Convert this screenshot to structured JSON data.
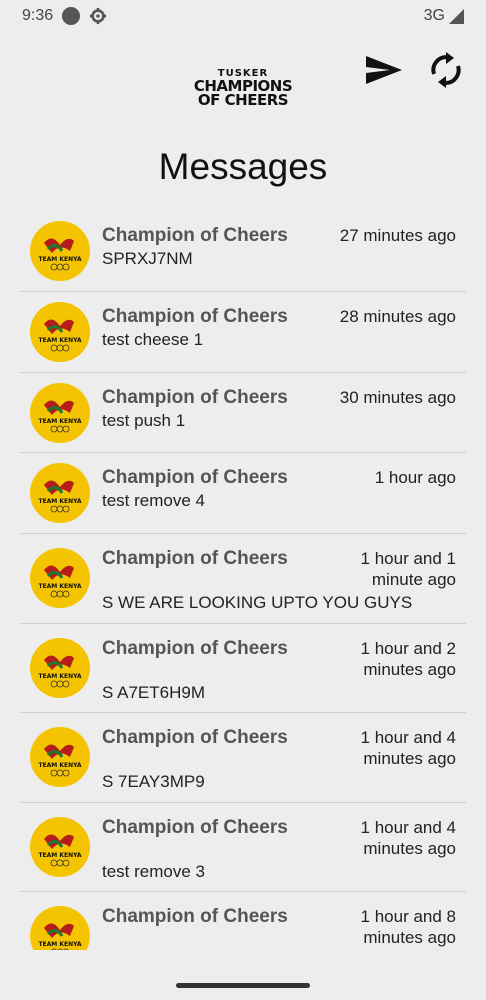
{
  "status_bar": {
    "time": "9:36",
    "network": "3G"
  },
  "header": {
    "logo_line1": "TUSKER",
    "logo_line2": "CHAMPIONS",
    "logo_line3": "OF CHEERS",
    "title": "Messages"
  },
  "avatar_text": "TEAM KENYA",
  "messages": [
    {
      "sender": "Champion of Cheers",
      "time": "27 minutes ago",
      "body": "SPRXJ7NM"
    },
    {
      "sender": "Champion of Cheers",
      "time": "28 minutes ago",
      "body": "test cheese 1"
    },
    {
      "sender": "Champion of Cheers",
      "time": "30 minutes ago",
      "body": "test push 1"
    },
    {
      "sender": "Champion of Cheers",
      "time": "1 hour ago",
      "body": "test remove 4"
    },
    {
      "sender": "Champion of Cheers",
      "time": "1 hour and 1 minute ago",
      "body": "S WE ARE LOOKING UPTO YOU GUYS"
    },
    {
      "sender": "Champion of Cheers",
      "time": "1 hour and 2 minutes ago",
      "body": "S A7ET6H9M"
    },
    {
      "sender": "Champion of Cheers",
      "time": "1 hour and 4 minutes ago",
      "body": "S 7EAY3MP9"
    },
    {
      "sender": "Champion of Cheers",
      "time": "1 hour and 4 minutes ago",
      "body": "test remove 3"
    },
    {
      "sender": "Champion of Cheers",
      "time": "1 hour and 8 minutes ago",
      "body": ""
    }
  ]
}
